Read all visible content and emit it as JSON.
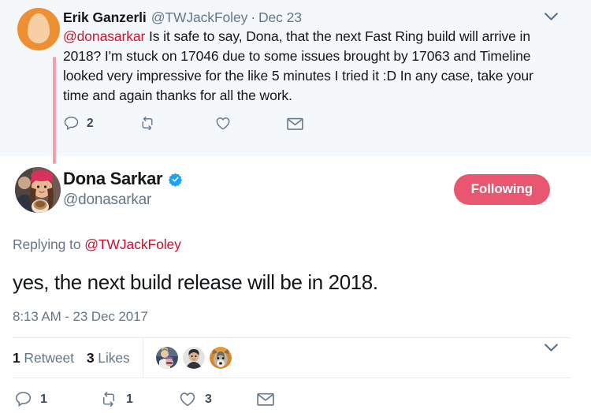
{
  "colors": {
    "parent_background": "#f5f8fa",
    "background": "#ffffff",
    "text": "#14171a",
    "muted": "#657786",
    "mention_red": "#d4132e",
    "follow_button": "#e8566f",
    "verified_blue": "#1da1f2",
    "thread_line": "#f3a0ad",
    "avatar_orange": "#ef8f34",
    "divider": "#e6ecf0"
  },
  "parent_tweet": {
    "display_name": "Erik Ganzerli",
    "handle": "@TWJackFoley",
    "separator": "·",
    "timestamp": "Dec 23",
    "avatar_name": "default-egg-avatar",
    "caret_icon": "chevron-down-icon",
    "text_parts": [
      {
        "type": "mention",
        "text": "@donasarkar"
      },
      {
        "type": "plain",
        "text": " Is it safe to say, Dona, that the next Fast Ring build will arrive in 2018? I'm stuck on 17046 due to some issues brought by 17063 and Timeline looked very impressive for the like 5 minutes I tried it :D In any case, take your time and again thanks for all the work."
      }
    ],
    "actions": [
      {
        "name": "reply",
        "icon": "reply-icon",
        "count": "2"
      },
      {
        "name": "retweet",
        "icon": "retweet-icon",
        "count": ""
      },
      {
        "name": "like",
        "icon": "heart-icon",
        "count": ""
      },
      {
        "name": "direct-message",
        "icon": "envelope-icon",
        "count": ""
      }
    ]
  },
  "main_tweet": {
    "display_name": "Dona Sarkar",
    "handle": "@donasarkar",
    "verified": true,
    "verified_icon": "verified-badge-icon",
    "avatar_name": "dona-sarkar-profile-photo",
    "follow_button_label": "Following",
    "caret_icon": "chevron-down-icon",
    "replying_to_prefix": "Replying to ",
    "replying_to_handle": "@TWJackFoley",
    "text": "yes, the next build release will be in 2018.",
    "timestamp": "8:13 AM - 23 Dec 2017",
    "stats": [
      {
        "count": "1",
        "label": " Retweet"
      },
      {
        "count": "3",
        "label": " Likes"
      }
    ],
    "engager_faces": [
      {
        "name": "engager-avatar-1"
      },
      {
        "name": "engager-avatar-2"
      },
      {
        "name": "engager-avatar-3"
      }
    ],
    "actions": [
      {
        "name": "reply",
        "icon": "reply-icon",
        "count": "1"
      },
      {
        "name": "retweet",
        "icon": "retweet-icon",
        "count": "1"
      },
      {
        "name": "like",
        "icon": "heart-icon",
        "count": "3"
      },
      {
        "name": "direct-message",
        "icon": "envelope-icon",
        "count": ""
      }
    ]
  }
}
